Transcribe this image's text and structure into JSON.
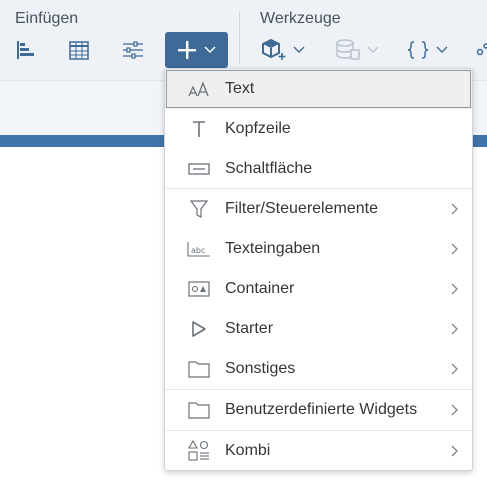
{
  "toolbar": {
    "insert_title": "Einfügen",
    "tools_title": "Werkzeuge",
    "accent_color": "#3f6a97"
  },
  "menu": {
    "items": [
      {
        "label": "Text",
        "icon": "text-size-icon",
        "submenu": false,
        "highlighted": true
      },
      {
        "label": "Kopfzeile",
        "icon": "heading-icon",
        "submenu": false
      },
      {
        "label": "Schaltfläche",
        "icon": "button-icon",
        "submenu": false
      },
      {
        "label": "Filter/Steuerelemente",
        "icon": "filter-icon",
        "submenu": true
      },
      {
        "label": "Texteingaben",
        "icon": "text-input-icon",
        "submenu": true
      },
      {
        "label": "Container",
        "icon": "container-icon",
        "submenu": true
      },
      {
        "label": "Starter",
        "icon": "play-icon",
        "submenu": true
      },
      {
        "label": "Sonstiges",
        "icon": "folder-icon",
        "submenu": true
      },
      {
        "label": "Benutzerdefinierte Widgets",
        "icon": "folder-icon",
        "submenu": true
      },
      {
        "label": "Kombi",
        "icon": "shapes-icon",
        "submenu": true
      }
    ]
  }
}
